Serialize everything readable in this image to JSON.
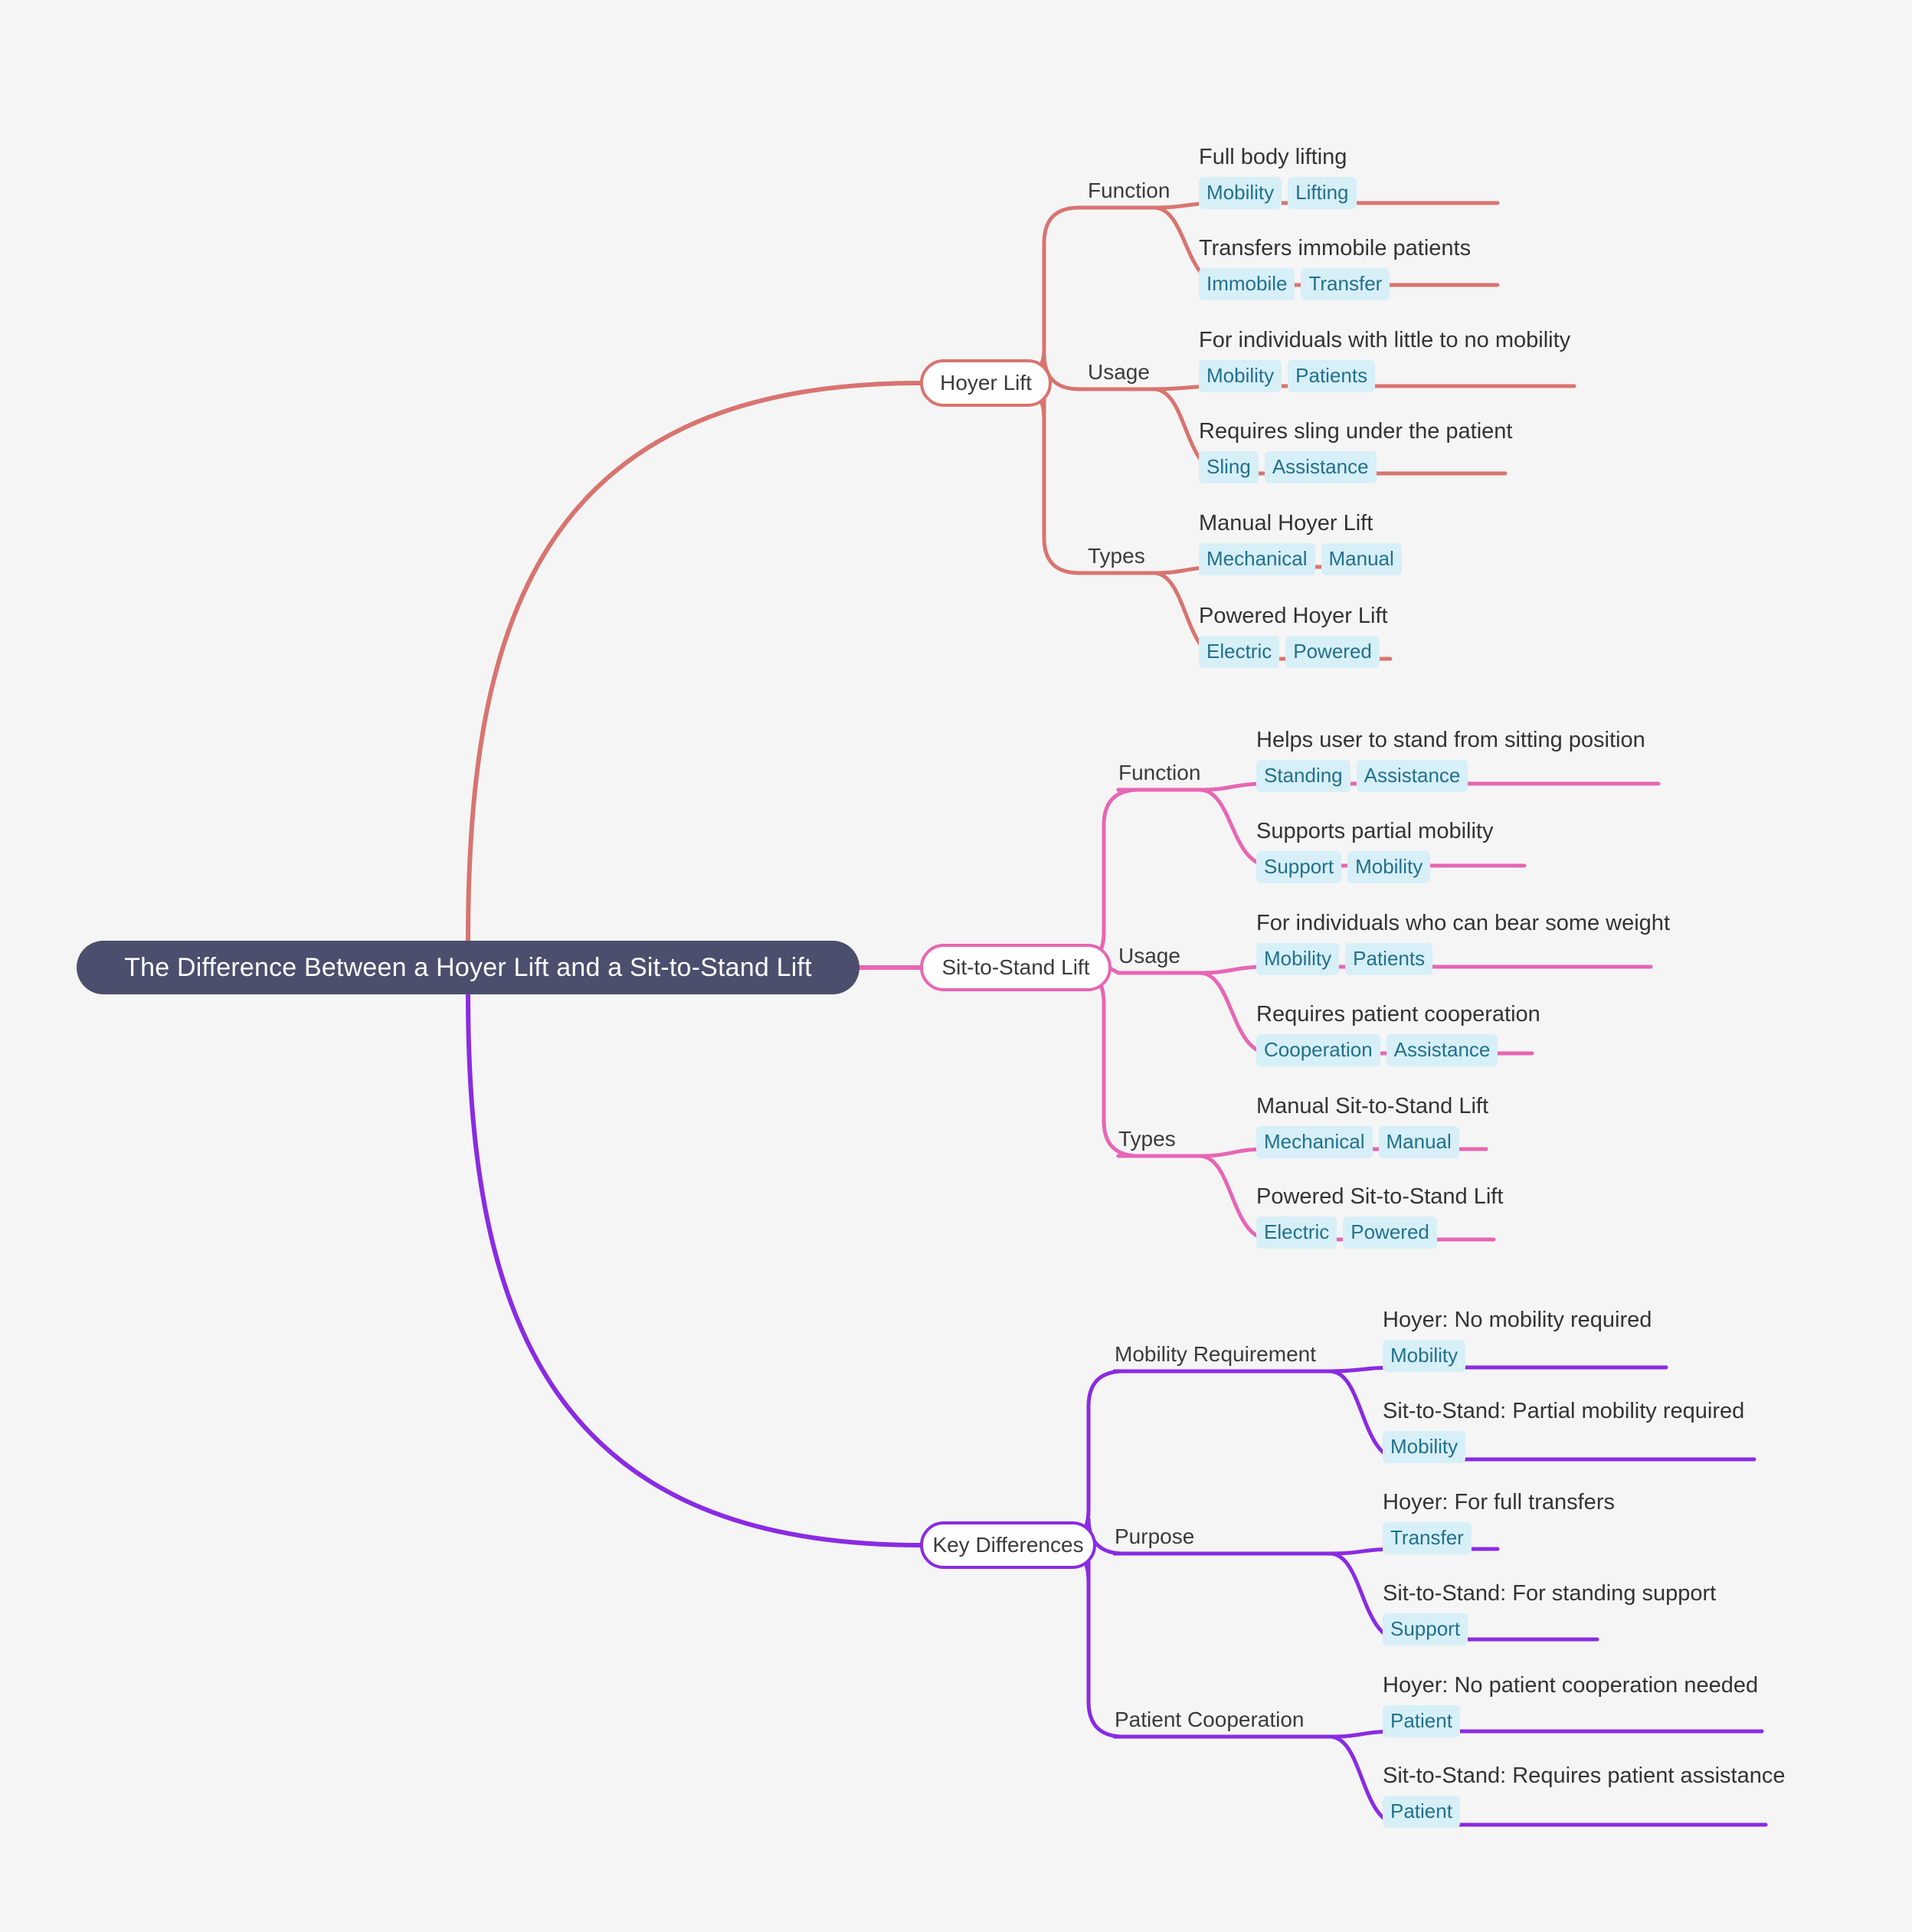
{
  "theme": {
    "background": "#f5f5f5",
    "root_fill": "#4b4e6d",
    "root_text": "#ffffff",
    "text": "#333333",
    "tag_bg": "#d7eff7",
    "tag_text": "#21718d",
    "branch_colors": [
      "#d87470",
      "#e766b4",
      "#8a2be2"
    ]
  },
  "root": {
    "title": "The Difference Between a Hoyer Lift and a Sit-to-Stand Lift"
  },
  "branches": [
    {
      "label": "Hoyer Lift",
      "color": "#d87470",
      "groups": [
        {
          "label": "Function",
          "leaves": [
            {
              "text": "Full body lifting",
              "tags": [
                "Mobility",
                "Lifting"
              ]
            },
            {
              "text": "Transfers immobile patients",
              "tags": [
                "Immobile",
                "Transfer"
              ]
            }
          ]
        },
        {
          "label": "Usage",
          "leaves": [
            {
              "text": "For individuals with little to no mobility",
              "tags": [
                "Mobility",
                "Patients"
              ]
            },
            {
              "text": "Requires sling under the patient",
              "tags": [
                "Sling",
                "Assistance"
              ]
            }
          ]
        },
        {
          "label": "Types",
          "leaves": [
            {
              "text": "Manual Hoyer Lift",
              "tags": [
                "Mechanical",
                "Manual"
              ]
            },
            {
              "text": "Powered Hoyer Lift",
              "tags": [
                "Electric",
                "Powered"
              ]
            }
          ]
        }
      ]
    },
    {
      "label": "Sit-to-Stand Lift",
      "color": "#e766b4",
      "groups": [
        {
          "label": "Function",
          "leaves": [
            {
              "text": "Helps user to stand from sitting position",
              "tags": [
                "Standing",
                "Assistance"
              ]
            },
            {
              "text": "Supports partial mobility",
              "tags": [
                "Support",
                "Mobility"
              ]
            }
          ]
        },
        {
          "label": "Usage",
          "leaves": [
            {
              "text": "For individuals who can bear some weight",
              "tags": [
                "Mobility",
                "Patients"
              ]
            },
            {
              "text": "Requires patient cooperation",
              "tags": [
                "Cooperation",
                "Assistance"
              ]
            }
          ]
        },
        {
          "label": "Types",
          "leaves": [
            {
              "text": "Manual Sit-to-Stand Lift",
              "tags": [
                "Mechanical",
                "Manual"
              ]
            },
            {
              "text": "Powered Sit-to-Stand Lift",
              "tags": [
                "Electric",
                "Powered"
              ]
            }
          ]
        }
      ]
    },
    {
      "label": "Key Differences",
      "color": "#8a2be2",
      "groups": [
        {
          "label": "Mobility Requirement",
          "leaves": [
            {
              "text": "Hoyer: No mobility required",
              "tags": [
                "Mobility"
              ]
            },
            {
              "text": "Sit-to-Stand: Partial mobility required",
              "tags": [
                "Mobility"
              ]
            }
          ]
        },
        {
          "label": "Purpose",
          "leaves": [
            {
              "text": "Hoyer: For full transfers",
              "tags": [
                "Transfer"
              ]
            },
            {
              "text": "Sit-to-Stand: For standing support",
              "tags": [
                "Support"
              ]
            }
          ]
        },
        {
          "label": "Patient Cooperation",
          "leaves": [
            {
              "text": "Hoyer: No patient cooperation needed",
              "tags": [
                "Patient"
              ]
            },
            {
              "text": "Sit-to-Stand: Requires patient assistance",
              "tags": [
                "Patient"
              ]
            }
          ]
        }
      ]
    }
  ]
}
